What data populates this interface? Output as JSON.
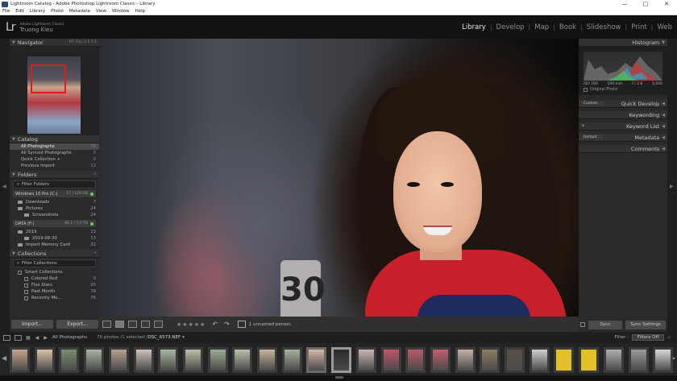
{
  "window": {
    "title": "Lightroom Catalog - Adobe Photoshop Lightroom Classic - Library",
    "controls": [
      "—",
      "□",
      "✕"
    ]
  },
  "menu": [
    "File",
    "Edit",
    "Library",
    "Photo",
    "Metadata",
    "View",
    "Window",
    "Help"
  ],
  "header": {
    "logo": "Lr",
    "product_line1": "Adobe Lightroom Classic",
    "product_line2": "Truong Kieu",
    "modules": [
      "Library",
      "Develop",
      "Map",
      "Book",
      "Slideshow",
      "Print",
      "Web"
    ],
    "active_module": "Library"
  },
  "navigator": {
    "title": "Navigator",
    "options": "FIT  FILL  1:1  1:1",
    "selected_option": "FILL"
  },
  "catalog": {
    "title": "Catalog",
    "items": [
      {
        "label": "All Photographs",
        "count": "76"
      },
      {
        "label": "All Synced Photographs",
        "count": "0"
      },
      {
        "label": "Quick Collection +",
        "count": "0"
      },
      {
        "label": "Previous Import",
        "count": "13"
      }
    ]
  },
  "folders": {
    "title": "Folders",
    "filter_label": "Filter Folders",
    "volumes": [
      {
        "label": "Windows 10 Pro (C:)",
        "value": "17 / 120 GB",
        "folders": [
          {
            "label": "Downloads",
            "count": "7",
            "indent": 0
          },
          {
            "label": "Pictures",
            "count": "24",
            "indent": 0
          },
          {
            "label": "Screenshots",
            "count": "24",
            "indent": 1
          }
        ]
      },
      {
        "label": "DATA (F:)",
        "value": "96.1 / 1.0 TB",
        "folders": [
          {
            "label": "2019",
            "count": "13",
            "indent": 0
          },
          {
            "label": "2019-08-30",
            "count": "13",
            "indent": 1
          },
          {
            "label": "Import Memory Card",
            "count": "32",
            "indent": 0
          }
        ]
      }
    ]
  },
  "collections": {
    "title": "Collections",
    "filter_label": "Filter Collections",
    "items": [
      {
        "label": "Smart Collections",
        "count": "",
        "indent": 0
      },
      {
        "label": "Colored Red",
        "count": "0",
        "indent": 1
      },
      {
        "label": "Five Stars",
        "count": "25",
        "indent": 1
      },
      {
        "label": "Past Month",
        "count": "76",
        "indent": 1
      },
      {
        "label": "Recently Mo...",
        "count": "76",
        "indent": 1
      }
    ]
  },
  "left_buttons": {
    "import": "Import...",
    "export": "Export..."
  },
  "right_panel": {
    "histogram": "Histogram",
    "histogram_info": [
      "ISO 200",
      "100 mm",
      "f / 2.8",
      "1/200"
    ],
    "original_photo": "Original Photo",
    "quick_develop": "Quick Develop",
    "quick_develop_preset": "Custom",
    "keywording": "Keywording",
    "keyword_list": "Keyword List",
    "metadata": "Metadata",
    "metadata_preset": "Default",
    "comments": "Comments"
  },
  "toolbar": {
    "stars": "★★★★★",
    "unnamed_person": "1 unnamed person"
  },
  "right_buttons": {
    "sync": "Sync",
    "sync_settings": "Sync Settings"
  },
  "filmstrip_bar": {
    "source": "All Photographs",
    "count": "76 photos /1 selected /",
    "file": "DSC_6573.NEF",
    "filter_label": "Filter :",
    "filter_value": "Filters Off"
  },
  "filmstrip": {
    "selected_index": 13,
    "thumb_colors": [
      "#c9a38a",
      "#d8c3a8",
      "#7a8e6a",
      "#a8b4a0",
      "#b6a08f",
      "#cfc2b8",
      "#a9b8a1",
      "#b8c1a2",
      "#9cab92",
      "#b9c2a7",
      "#c8b49a",
      "#a5b29a",
      "#d7b7a7",
      "#2c2a2c",
      "#cbb7b0",
      "#c25468",
      "#b85c68",
      "#c06070",
      "#c4b2a8",
      "#8a7d62",
      "#5a5048",
      "#d0d0d0",
      "#e2c02a",
      "#e2c02a",
      "#b0b0b0",
      "#9a9a9a",
      "#d9d9d9"
    ]
  },
  "colors": {
    "accent_red": "#e21c1c",
    "panel_bg": "#2a2a2a",
    "yellow_label": "#e2c02a"
  }
}
